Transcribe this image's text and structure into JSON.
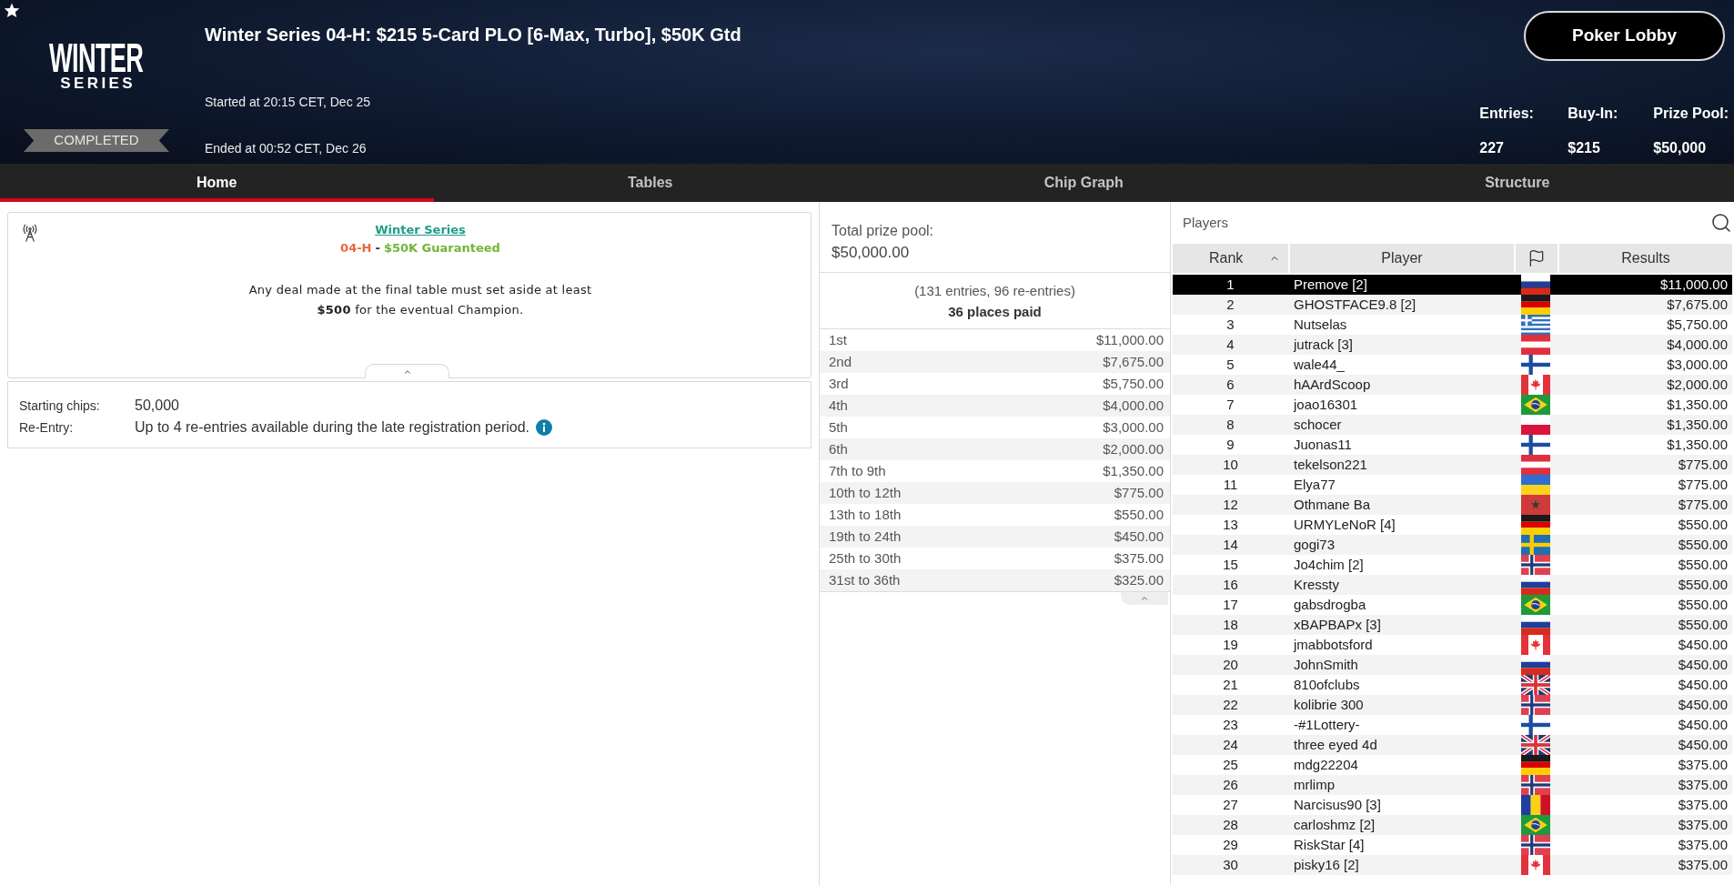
{
  "header": {
    "logo": {
      "line1": "WINTER",
      "line2": "SERIES"
    },
    "status_badge": "COMPLETED",
    "title": "Winter Series 04-H: $215 5-Card PLO [6-Max, Turbo], $50K Gtd",
    "started": "Started at 20:15 CET, Dec 25",
    "ended": "Ended at 00:52 CET, Dec 26",
    "lobby_button": "Poker Lobby",
    "stats": [
      {
        "label": "Entries:",
        "value": "227"
      },
      {
        "label": "Buy-In:",
        "value": "$215"
      },
      {
        "label": "Prize Pool:",
        "value": "$50,000"
      }
    ]
  },
  "tabs": [
    {
      "label": "Home",
      "selected": true
    },
    {
      "label": "Tables",
      "selected": false
    },
    {
      "label": "Chip Graph",
      "selected": false
    },
    {
      "label": "Structure",
      "selected": false
    }
  ],
  "info_card": {
    "series_link": "Winter Series",
    "event_code": "04-H",
    "separator": "-",
    "guarantee": "$50K Guaranteed",
    "notice_lines": [
      "Any deal made at the final table must set aside at least",
      "**$500** for the eventual Champion."
    ],
    "expanded": true
  },
  "details": [
    {
      "label": "Starting chips:",
      "value": "50,000",
      "info": false
    },
    {
      "label": "Re-Entry:",
      "value": "Up to 4 re-entries available during the late registration period.",
      "info": true
    }
  ],
  "prize_pool": {
    "label": "Total prize pool:",
    "amount": "$50,000.00",
    "entries_note": "(131 entries, 96 re-entries)",
    "places_paid": "36 places paid",
    "expanded": true,
    "payouts": [
      {
        "place": "1st",
        "amount": "$11,000.00"
      },
      {
        "place": "2nd",
        "amount": "$7,675.00"
      },
      {
        "place": "3rd",
        "amount": "$5,750.00"
      },
      {
        "place": "4th",
        "amount": "$4,000.00"
      },
      {
        "place": "5th",
        "amount": "$3,000.00"
      },
      {
        "place": "6th",
        "amount": "$2,000.00"
      },
      {
        "place": "7th to 9th",
        "amount": "$1,350.00"
      },
      {
        "place": "10th to 12th",
        "amount": "$775.00"
      },
      {
        "place": "13th to 18th",
        "amount": "$550.00"
      },
      {
        "place": "19th to 24th",
        "amount": "$450.00"
      },
      {
        "place": "25th to 30th",
        "amount": "$375.00"
      },
      {
        "place": "31st to 36th",
        "amount": "$325.00"
      }
    ]
  },
  "players": {
    "title": "Players",
    "columns": [
      {
        "kind": "text",
        "label": "Rank",
        "sorted": true
      },
      {
        "kind": "text",
        "label": "Player",
        "sorted": false
      },
      {
        "kind": "flag",
        "sorted": false
      },
      {
        "kind": "text",
        "label": "Results",
        "sorted": false
      }
    ],
    "rows": [
      {
        "rank": "1",
        "player": "Premove [2]",
        "flag": {
          "kind": "russia"
        },
        "result": "$11,000.00",
        "selected": true
      },
      {
        "rank": "2",
        "player": "GHOSTFACE9.8 [2]",
        "flag": {
          "kind": "germany"
        },
        "result": "$7,675.00",
        "selected": false
      },
      {
        "rank": "3",
        "player": "Nutselas",
        "flag": {
          "kind": "greece"
        },
        "result": "$5,750.00",
        "selected": false
      },
      {
        "rank": "4",
        "player": "jutrack [3]",
        "flag": {
          "kind": "austria"
        },
        "result": "$4,000.00",
        "selected": false
      },
      {
        "rank": "5",
        "player": "wale44_",
        "flag": {
          "kind": "finland"
        },
        "result": "$3,000.00",
        "selected": false
      },
      {
        "rank": "6",
        "player": "hAArdScoop",
        "flag": {
          "kind": "canada"
        },
        "result": "$2,000.00",
        "selected": false
      },
      {
        "rank": "7",
        "player": "joao16301",
        "flag": {
          "kind": "brazil"
        },
        "result": "$1,350.00",
        "selected": false
      },
      {
        "rank": "8",
        "player": "schocer",
        "flag": {
          "kind": "poland"
        },
        "result": "$1,350.00",
        "selected": false
      },
      {
        "rank": "9",
        "player": "Juonas11",
        "flag": {
          "kind": "finland"
        },
        "result": "$1,350.00",
        "selected": false
      },
      {
        "rank": "10",
        "player": "tekelson221",
        "flag": {
          "kind": "austria"
        },
        "result": "$775.00",
        "selected": false
      },
      {
        "rank": "11",
        "player": "Elya77",
        "flag": {
          "kind": "ukraine"
        },
        "result": "$775.00",
        "selected": false
      },
      {
        "rank": "12",
        "player": "Othmane Ba",
        "flag": {
          "kind": "morocco"
        },
        "result": "$775.00",
        "selected": false
      },
      {
        "rank": "13",
        "player": "URMYLeNoR [4]",
        "flag": {
          "kind": "germany"
        },
        "result": "$550.00",
        "selected": false
      },
      {
        "rank": "14",
        "player": "gogi73",
        "flag": {
          "kind": "sweden"
        },
        "result": "$550.00",
        "selected": false
      },
      {
        "rank": "15",
        "player": "Jo4chim [2]",
        "flag": {
          "kind": "norway"
        },
        "result": "$550.00",
        "selected": false
      },
      {
        "rank": "16",
        "player": "Kressty",
        "flag": {
          "kind": "russia"
        },
        "result": "$550.00",
        "selected": false
      },
      {
        "rank": "17",
        "player": "gabsdrogba",
        "flag": {
          "kind": "brazil"
        },
        "result": "$550.00",
        "selected": false
      },
      {
        "rank": "18",
        "player": "xBAPBAPx [3]",
        "flag": {
          "kind": "russia"
        },
        "result": "$550.00",
        "selected": false
      },
      {
        "rank": "19",
        "player": "jmabbotsford",
        "flag": {
          "kind": "canada"
        },
        "result": "$450.00",
        "selected": false
      },
      {
        "rank": "20",
        "player": "JohnSmith",
        "flag": {
          "kind": "russia"
        },
        "result": "$450.00",
        "selected": false
      },
      {
        "rank": "21",
        "player": "810ofclubs",
        "flag": {
          "kind": "britain"
        },
        "result": "$450.00",
        "selected": false
      },
      {
        "rank": "22",
        "player": "kolibrie 300",
        "flag": {
          "kind": "norway"
        },
        "result": "$450.00",
        "selected": false
      },
      {
        "rank": "23",
        "player": "-#1Lottery-",
        "flag": {
          "kind": "finland"
        },
        "result": "$450.00",
        "selected": false
      },
      {
        "rank": "24",
        "player": "three eyed 4d",
        "flag": {
          "kind": "britain"
        },
        "result": "$450.00",
        "selected": false
      },
      {
        "rank": "25",
        "player": "mdg22204",
        "flag": {
          "kind": "germany"
        },
        "result": "$375.00",
        "selected": false
      },
      {
        "rank": "26",
        "player": "mrlimp",
        "flag": {
          "kind": "norway"
        },
        "result": "$375.00",
        "selected": false
      },
      {
        "rank": "27",
        "player": "Narcisus90 [3]",
        "flag": {
          "kind": "romania"
        },
        "result": "$375.00",
        "selected": false
      },
      {
        "rank": "28",
        "player": "carloshmz [2]",
        "flag": {
          "kind": "brazil"
        },
        "result": "$375.00",
        "selected": false
      },
      {
        "rank": "29",
        "player": "RiskStar [4]",
        "flag": {
          "kind": "norway"
        },
        "result": "$375.00",
        "selected": false
      },
      {
        "rank": "30",
        "player": "pisky16 [2]",
        "flag": {
          "kind": "canada"
        },
        "result": "$375.00",
        "selected": false
      }
    ]
  }
}
